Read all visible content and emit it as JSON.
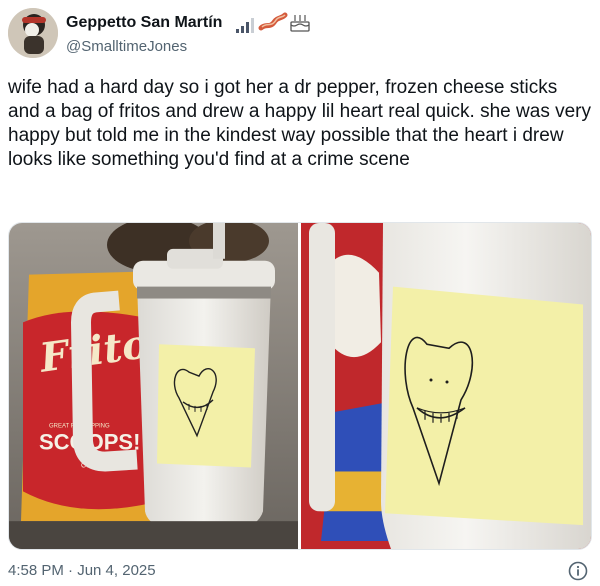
{
  "author": {
    "display_name": "Geppetto San Martín",
    "handle": "@SmalltimeJones",
    "badge_icons": [
      "signal-bars-icon",
      "bacon-icon",
      "cake-icon"
    ]
  },
  "tweet": {
    "text": "wife had a hard day so i got her a dr pepper, frozen cheese sticks and a bag of fritos and drew a happy lil heart real quick. she was very happy but told me in the kindest way possible that the heart i drew looks like something you'd find at a crime scene",
    "timestamp": "4:58 PM · Jun 4, 2025"
  },
  "media": {
    "left_photo": {
      "bag_brand": "Fritos",
      "bag_product": "SCOOPS!",
      "bag_sub": "CORN CHIPS",
      "bag_tag": "GREAT FOR DIPPING"
    }
  },
  "colors": {
    "text_primary": "#0f1419",
    "text_secondary": "#536471",
    "sticky_note": "#f3f0a8"
  },
  "icons": {
    "info": "info-circle-icon"
  }
}
